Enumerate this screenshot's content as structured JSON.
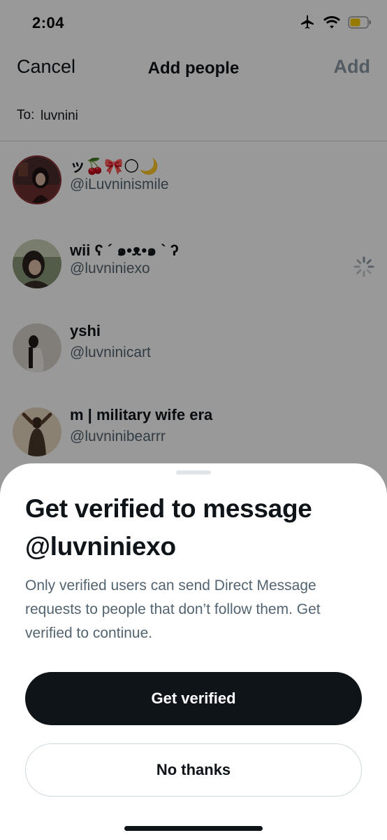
{
  "status_bar": {
    "time": "2:04",
    "icons": [
      "airplane-icon",
      "wifi-icon",
      "battery-icon"
    ],
    "battery_color": "#ffcc00"
  },
  "nav": {
    "cancel_label": "Cancel",
    "title": "Add people",
    "add_label": "Add"
  },
  "recipient": {
    "label": "To:",
    "value": "luvnini"
  },
  "results": [
    {
      "name": "ッ🍒🎀🌕🌙",
      "handle": "@iLuvninismile"
    },
    {
      "name": "wii ʕ ´ ๑•ᴥ•๑ ` ʔ",
      "handle": "@luvniniexo",
      "loading": true
    },
    {
      "name": "yshi",
      "handle": "@luvninicart"
    },
    {
      "name": "m | military wife era",
      "handle": "@luvninibearrr"
    }
  ],
  "sheet": {
    "title": "Get verified to message @luvniniexo",
    "body": "Only verified users can send Direct Message requests to people that don’t follow them. Get verified to continue.",
    "primary_label": "Get verified",
    "secondary_label": "No thanks"
  },
  "colors": {
    "primary_button": "#0f1419",
    "secondary_text": "#536471",
    "disabled": "#8b98a5"
  }
}
